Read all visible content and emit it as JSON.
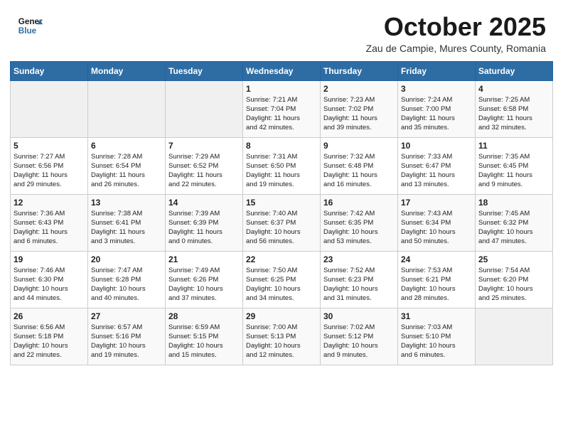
{
  "header": {
    "logo_line1": "General",
    "logo_line2": "Blue",
    "month_title": "October 2025",
    "subtitle": "Zau de Campie, Mures County, Romania"
  },
  "weekdays": [
    "Sunday",
    "Monday",
    "Tuesday",
    "Wednesday",
    "Thursday",
    "Friday",
    "Saturday"
  ],
  "weeks": [
    [
      {
        "day": "",
        "info": ""
      },
      {
        "day": "",
        "info": ""
      },
      {
        "day": "",
        "info": ""
      },
      {
        "day": "1",
        "info": "Sunrise: 7:21 AM\nSunset: 7:04 PM\nDaylight: 11 hours\nand 42 minutes."
      },
      {
        "day": "2",
        "info": "Sunrise: 7:23 AM\nSunset: 7:02 PM\nDaylight: 11 hours\nand 39 minutes."
      },
      {
        "day": "3",
        "info": "Sunrise: 7:24 AM\nSunset: 7:00 PM\nDaylight: 11 hours\nand 35 minutes."
      },
      {
        "day": "4",
        "info": "Sunrise: 7:25 AM\nSunset: 6:58 PM\nDaylight: 11 hours\nand 32 minutes."
      }
    ],
    [
      {
        "day": "5",
        "info": "Sunrise: 7:27 AM\nSunset: 6:56 PM\nDaylight: 11 hours\nand 29 minutes."
      },
      {
        "day": "6",
        "info": "Sunrise: 7:28 AM\nSunset: 6:54 PM\nDaylight: 11 hours\nand 26 minutes."
      },
      {
        "day": "7",
        "info": "Sunrise: 7:29 AM\nSunset: 6:52 PM\nDaylight: 11 hours\nand 22 minutes."
      },
      {
        "day": "8",
        "info": "Sunrise: 7:31 AM\nSunset: 6:50 PM\nDaylight: 11 hours\nand 19 minutes."
      },
      {
        "day": "9",
        "info": "Sunrise: 7:32 AM\nSunset: 6:48 PM\nDaylight: 11 hours\nand 16 minutes."
      },
      {
        "day": "10",
        "info": "Sunrise: 7:33 AM\nSunset: 6:47 PM\nDaylight: 11 hours\nand 13 minutes."
      },
      {
        "day": "11",
        "info": "Sunrise: 7:35 AM\nSunset: 6:45 PM\nDaylight: 11 hours\nand 9 minutes."
      }
    ],
    [
      {
        "day": "12",
        "info": "Sunrise: 7:36 AM\nSunset: 6:43 PM\nDaylight: 11 hours\nand 6 minutes."
      },
      {
        "day": "13",
        "info": "Sunrise: 7:38 AM\nSunset: 6:41 PM\nDaylight: 11 hours\nand 3 minutes."
      },
      {
        "day": "14",
        "info": "Sunrise: 7:39 AM\nSunset: 6:39 PM\nDaylight: 11 hours\nand 0 minutes."
      },
      {
        "day": "15",
        "info": "Sunrise: 7:40 AM\nSunset: 6:37 PM\nDaylight: 10 hours\nand 56 minutes."
      },
      {
        "day": "16",
        "info": "Sunrise: 7:42 AM\nSunset: 6:35 PM\nDaylight: 10 hours\nand 53 minutes."
      },
      {
        "day": "17",
        "info": "Sunrise: 7:43 AM\nSunset: 6:34 PM\nDaylight: 10 hours\nand 50 minutes."
      },
      {
        "day": "18",
        "info": "Sunrise: 7:45 AM\nSunset: 6:32 PM\nDaylight: 10 hours\nand 47 minutes."
      }
    ],
    [
      {
        "day": "19",
        "info": "Sunrise: 7:46 AM\nSunset: 6:30 PM\nDaylight: 10 hours\nand 44 minutes."
      },
      {
        "day": "20",
        "info": "Sunrise: 7:47 AM\nSunset: 6:28 PM\nDaylight: 10 hours\nand 40 minutes."
      },
      {
        "day": "21",
        "info": "Sunrise: 7:49 AM\nSunset: 6:26 PM\nDaylight: 10 hours\nand 37 minutes."
      },
      {
        "day": "22",
        "info": "Sunrise: 7:50 AM\nSunset: 6:25 PM\nDaylight: 10 hours\nand 34 minutes."
      },
      {
        "day": "23",
        "info": "Sunrise: 7:52 AM\nSunset: 6:23 PM\nDaylight: 10 hours\nand 31 minutes."
      },
      {
        "day": "24",
        "info": "Sunrise: 7:53 AM\nSunset: 6:21 PM\nDaylight: 10 hours\nand 28 minutes."
      },
      {
        "day": "25",
        "info": "Sunrise: 7:54 AM\nSunset: 6:20 PM\nDaylight: 10 hours\nand 25 minutes."
      }
    ],
    [
      {
        "day": "26",
        "info": "Sunrise: 6:56 AM\nSunset: 5:18 PM\nDaylight: 10 hours\nand 22 minutes."
      },
      {
        "day": "27",
        "info": "Sunrise: 6:57 AM\nSunset: 5:16 PM\nDaylight: 10 hours\nand 19 minutes."
      },
      {
        "day": "28",
        "info": "Sunrise: 6:59 AM\nSunset: 5:15 PM\nDaylight: 10 hours\nand 15 minutes."
      },
      {
        "day": "29",
        "info": "Sunrise: 7:00 AM\nSunset: 5:13 PM\nDaylight: 10 hours\nand 12 minutes."
      },
      {
        "day": "30",
        "info": "Sunrise: 7:02 AM\nSunset: 5:12 PM\nDaylight: 10 hours\nand 9 minutes."
      },
      {
        "day": "31",
        "info": "Sunrise: 7:03 AM\nSunset: 5:10 PM\nDaylight: 10 hours\nand 6 minutes."
      },
      {
        "day": "",
        "info": ""
      }
    ]
  ]
}
